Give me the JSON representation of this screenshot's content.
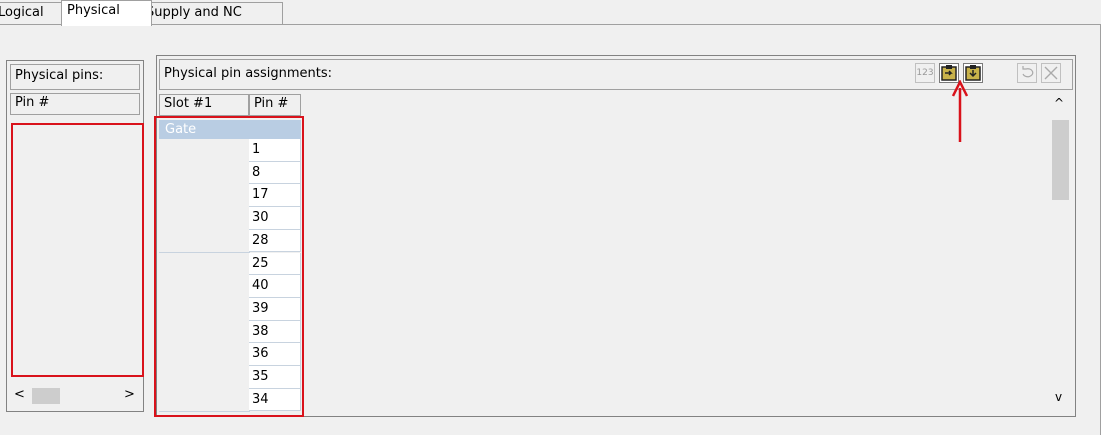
{
  "tabs": [
    {
      "label": "Logical",
      "active": false
    },
    {
      "label": "Physical",
      "active": true
    },
    {
      "label": "Supply and NC",
      "active": false
    }
  ],
  "left_panel": {
    "title": "Physical pins:",
    "column": "Pin #",
    "scroll_left": "<",
    "scroll_right": ">"
  },
  "right_panel": {
    "title": "Physical pin assignments:",
    "columns": [
      "Slot #1",
      "Pin #"
    ],
    "group_label": "Gate",
    "pins": [
      "1",
      "8",
      "17",
      "30",
      "28",
      "25",
      "40",
      "39",
      "38",
      "36",
      "35",
      "34"
    ],
    "scroll_up": "^",
    "scroll_down": "v",
    "toolbar": {
      "renumber": "123",
      "paste": "paste-from-clipboard",
      "export": "export-to-clipboard",
      "undo": "undo",
      "delete": "delete"
    }
  },
  "colors": {
    "highlight": "#d9121b",
    "gate_row": "#b9cde3"
  }
}
